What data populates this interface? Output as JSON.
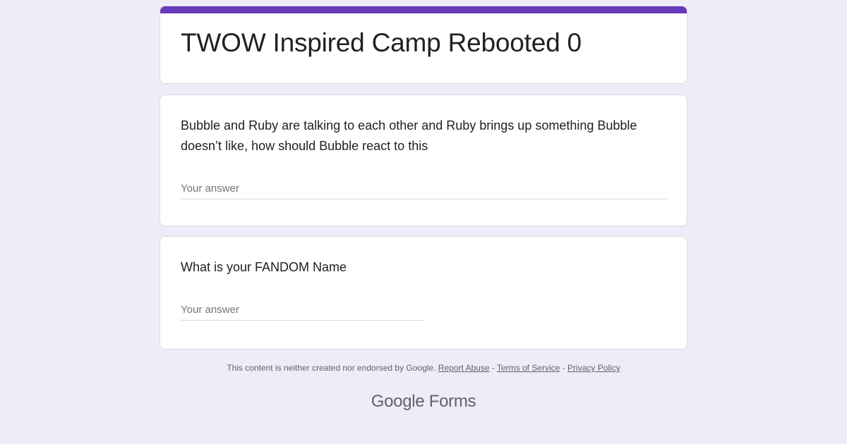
{
  "form": {
    "title": "TWOW Inspired Camp Rebooted 0",
    "accent_color": "#673ab7",
    "background_color": "#f0ebf8"
  },
  "questions": [
    {
      "text": "Bubble and Ruby are talking to each other and Ruby brings up something Bubble doesn’t like, how should Bubble react to this",
      "placeholder": "Your answer"
    },
    {
      "text": "What is your FANDOM Name",
      "placeholder": "Your answer"
    }
  ],
  "footer": {
    "disclaimer": "This content is neither created nor endorsed by Google.",
    "report_abuse": "Report Abuse",
    "terms": "Terms of Service",
    "privacy": "Privacy Policy",
    "separator": "-"
  },
  "brand": {
    "google": "Google",
    "forms": "Forms"
  }
}
